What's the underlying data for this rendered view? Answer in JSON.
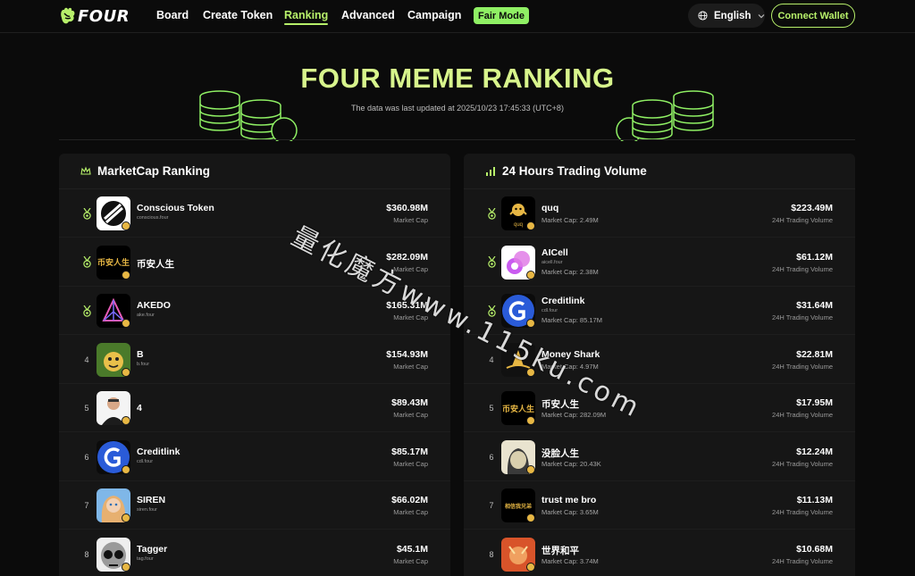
{
  "nav": {
    "logo_text": "FOUR",
    "links": [
      "Board",
      "Create Token",
      "Ranking",
      "Advanced",
      "Campaign"
    ],
    "fair_mode": "Fair Mode",
    "language": "English",
    "connect_wallet": "Connect Wallet"
  },
  "hero": {
    "title": "FOUR MEME RANKING",
    "subtitle": "The data was last updated at 2025/10/23 17:45:33 (UTC+8)"
  },
  "marketcap": {
    "title": "MarketCap Ranking",
    "value_label": "Market Cap",
    "rows": [
      {
        "rank": "",
        "name": "Conscious Token",
        "ticker": "conscious.four",
        "value": "$360.98M"
      },
      {
        "rank": "",
        "name": "币安人生",
        "ticker": "",
        "value": "$282.09M"
      },
      {
        "rank": "",
        "name": "AKEDO",
        "ticker": "ake.four",
        "value": "$165.31M"
      },
      {
        "rank": "4",
        "name": "B",
        "ticker": "b.four",
        "value": "$154.93M"
      },
      {
        "rank": "5",
        "name": "4",
        "ticker": "",
        "value": "$89.43M"
      },
      {
        "rank": "6",
        "name": "Creditlink",
        "ticker": "cdl.four",
        "value": "$85.17M"
      },
      {
        "rank": "7",
        "name": "SIREN",
        "ticker": "siren.four",
        "value": "$66.02M"
      },
      {
        "rank": "8",
        "name": "Tagger",
        "ticker": "tag.four",
        "value": "$45.1M"
      }
    ]
  },
  "volume": {
    "title": "24 Hours Trading Volume",
    "value_label": "24H Trading Volume",
    "rows": [
      {
        "rank": "",
        "name": "quq",
        "ticker": "",
        "cap": "Market Cap: 2.49M",
        "value": "$223.49M"
      },
      {
        "rank": "",
        "name": "AICell",
        "ticker": "aicell.four",
        "cap": "Market Cap: 2.38M",
        "value": "$61.12M"
      },
      {
        "rank": "",
        "name": "Creditlink",
        "ticker": "cdl.four",
        "cap": "Market Cap: 85.17M",
        "value": "$31.64M"
      },
      {
        "rank": "4",
        "name": "Money Shark",
        "ticker": "",
        "cap": "Market Cap: 4.97M",
        "value": "$22.81M"
      },
      {
        "rank": "5",
        "name": "币安人生",
        "ticker": "",
        "cap": "Market Cap: 282.09M",
        "value": "$17.95M"
      },
      {
        "rank": "6",
        "name": "没脸人生",
        "ticker": "",
        "cap": "Market Cap: 20.43K",
        "value": "$12.24M"
      },
      {
        "rank": "7",
        "name": "trust me bro",
        "ticker": "",
        "cap": "Market Cap: 3.65M",
        "value": "$11.13M"
      },
      {
        "rank": "8",
        "name": "世界和平",
        "ticker": "",
        "cap": "Market Cap: 3.74M",
        "value": "$10.68M"
      }
    ]
  },
  "avatar_text": {
    "binance_life": "币安人生",
    "quq": "quq",
    "trust_me_bro": "相信我兄弟"
  },
  "watermark": "量化魔方www.115ku.com",
  "colors": {
    "accent": "#b7f06a",
    "title": "#d8f58c",
    "fair": "#8ff064",
    "badge": "#e7b744"
  }
}
